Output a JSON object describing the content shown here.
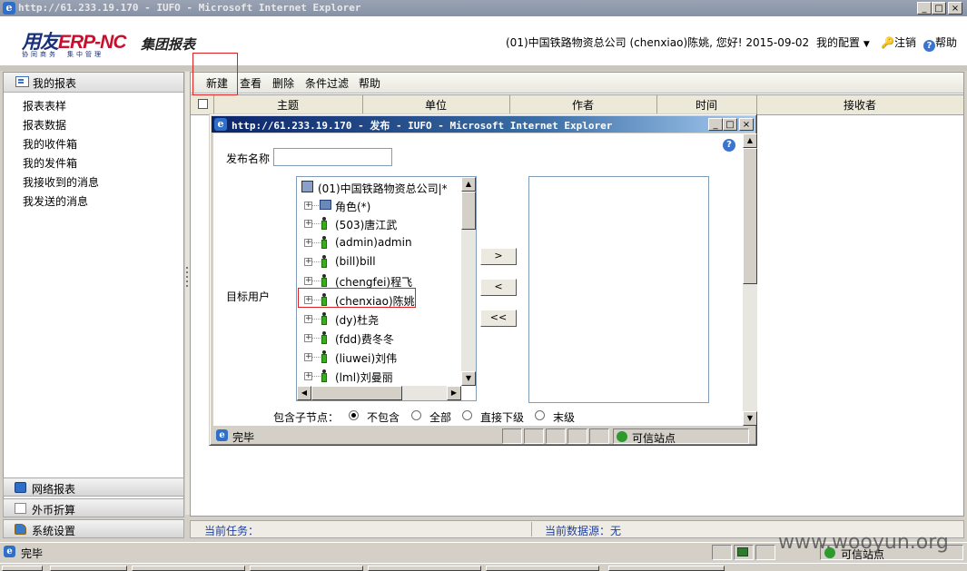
{
  "ie_window": {
    "title": "http://61.233.19.170 - IUFO - Microsoft Internet Explorer",
    "icon": "ie-icon",
    "controls": [
      "_",
      "□",
      "×"
    ]
  },
  "header": {
    "logo_text": "用友",
    "logo_erp": "ERP-NC",
    "logo_sub": "协同商务　集中管理",
    "module_title": "集团报表",
    "user_info": "(01)中国铁路物资总公司 (chenxiao)陈姚, 您好! 2015-09-02",
    "my_config": "我的配置",
    "logout": "注销",
    "help": "帮助"
  },
  "sidebar": {
    "header": "我的报表",
    "items": [
      {
        "label": "报表表样"
      },
      {
        "label": "报表数据"
      },
      {
        "label": "我的收件箱"
      },
      {
        "label": "我的发件箱"
      },
      {
        "label": "我接收到的消息"
      },
      {
        "label": "我发送的消息"
      }
    ],
    "accordion": [
      {
        "label": "网络报表",
        "icon": "network-report-icon"
      },
      {
        "label": "外币折算",
        "icon": "currency-icon"
      },
      {
        "label": "系统设置",
        "icon": "settings-icon"
      }
    ]
  },
  "toolbar": {
    "new": "新建",
    "view": "查看",
    "delete": "删除",
    "filter": "条件过滤",
    "help": "帮助"
  },
  "grid": {
    "columns": [
      "主题",
      "单位",
      "作者",
      "时间",
      "接收者"
    ]
  },
  "status_bar": {
    "current_task": "当前任务：",
    "current_source": "当前数据源：无"
  },
  "ie_status": {
    "text": "完毕",
    "zone": "可信站点"
  },
  "dialog": {
    "title": "http://61.233.19.170 - 发布 - IUFO - Microsoft Internet Explorer",
    "publish_name_label": "发布名称",
    "publish_name_value": "",
    "target_users_label": "目标用户",
    "tree_root": "(01)中国铁路物资总公司|*",
    "tree_items": [
      {
        "label": "角色(*)",
        "type": "role"
      },
      {
        "label": "(503)唐江武",
        "type": "user"
      },
      {
        "label": "(admin)admin",
        "type": "user"
      },
      {
        "label": "(bill)bill",
        "type": "user"
      },
      {
        "label": "(chengfei)程飞",
        "type": "user"
      },
      {
        "label": "(chenxiao)陈姚",
        "type": "user"
      },
      {
        "label": "(dy)杜尧",
        "type": "user"
      },
      {
        "label": "(fdd)费冬冬",
        "type": "user"
      },
      {
        "label": "(liuwei)刘伟",
        "type": "user"
      },
      {
        "label": "(lml)刘曼丽",
        "type": "user"
      }
    ],
    "buttons": {
      "add": ">",
      "remove": "<",
      "remove_all": "<<"
    },
    "include_child_label": "包含子节点：",
    "include_options": [
      {
        "label": "不包含",
        "selected": true
      },
      {
        "label": "全部",
        "selected": false
      },
      {
        "label": "直接下级",
        "selected": false
      },
      {
        "label": "末级",
        "selected": false
      }
    ],
    "status": "完毕",
    "zone": "可信站点"
  },
  "watermark": "www.wooyun.org"
}
